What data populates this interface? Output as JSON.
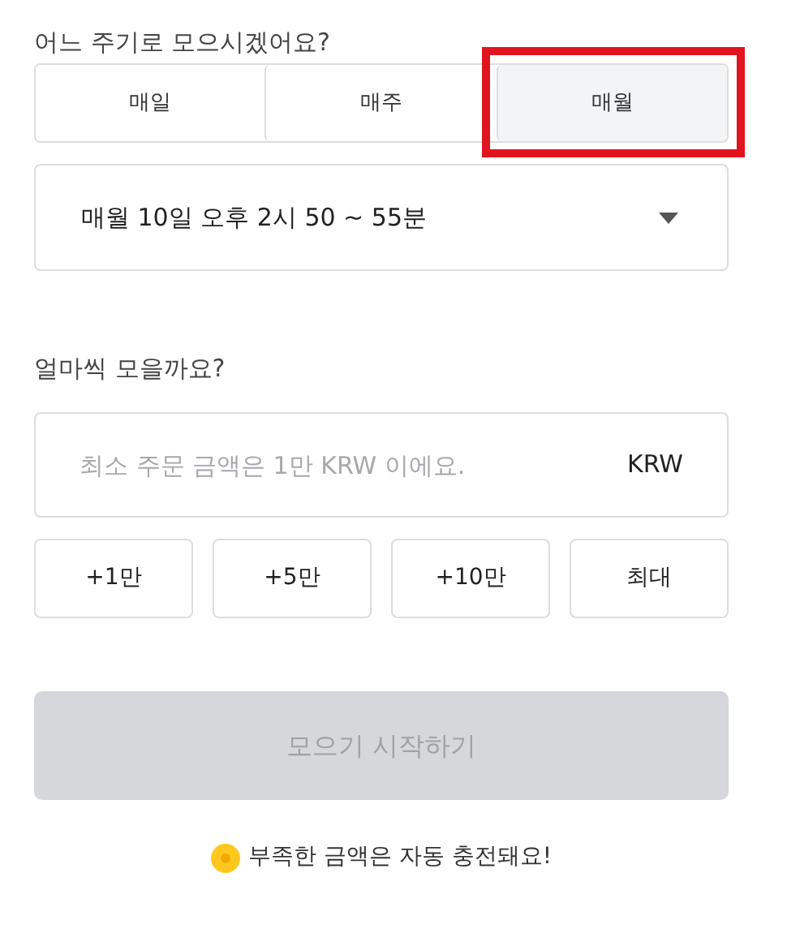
{
  "cycle_question": "어느 주기로 모으시겠어요?",
  "cycle_tabs": [
    {
      "label": "매일",
      "selected": false,
      "highlighted": false
    },
    {
      "label": "매주",
      "selected": false,
      "highlighted": false
    },
    {
      "label": "매월",
      "selected": true,
      "highlighted": true
    }
  ],
  "schedule_select": {
    "value": "매월 10일 오후 2시 50 ~ 55분"
  },
  "amount_question": "얼마씩 모을까요?",
  "amount_field": {
    "placeholder": "최소 주문 금액은 1만 KRW 이에요.",
    "unit": "KRW"
  },
  "quick_amounts": [
    "+1만",
    "+5만",
    "+10만",
    "최대"
  ],
  "start_button": {
    "label": "모으기 시작하기",
    "disabled": true
  },
  "footnote": "부족한 금액은 자동 충전돼요!"
}
